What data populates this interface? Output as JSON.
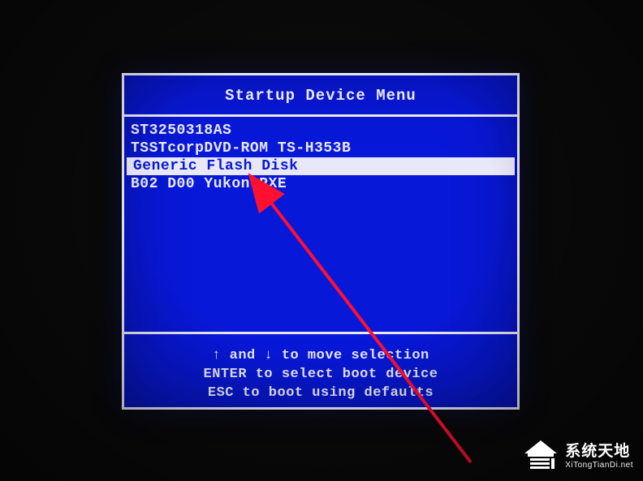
{
  "title": "Startup Device Menu",
  "menu": {
    "items": [
      {
        "label": "ST3250318AS",
        "selected": false
      },
      {
        "label": "TSSTcorpDVD-ROM TS-H353B",
        "selected": false
      },
      {
        "label": "Generic Flash Disk",
        "selected": true
      },
      {
        "label": "B02 D00 Yukon PXE",
        "selected": false
      }
    ]
  },
  "help": {
    "line1": "↑ and ↓ to move selection",
    "line2": "ENTER to select boot device",
    "line3": "ESC to boot using defaults"
  },
  "watermark": {
    "brand_cn": "系统天地",
    "url": "XiTongTianDi.net"
  }
}
